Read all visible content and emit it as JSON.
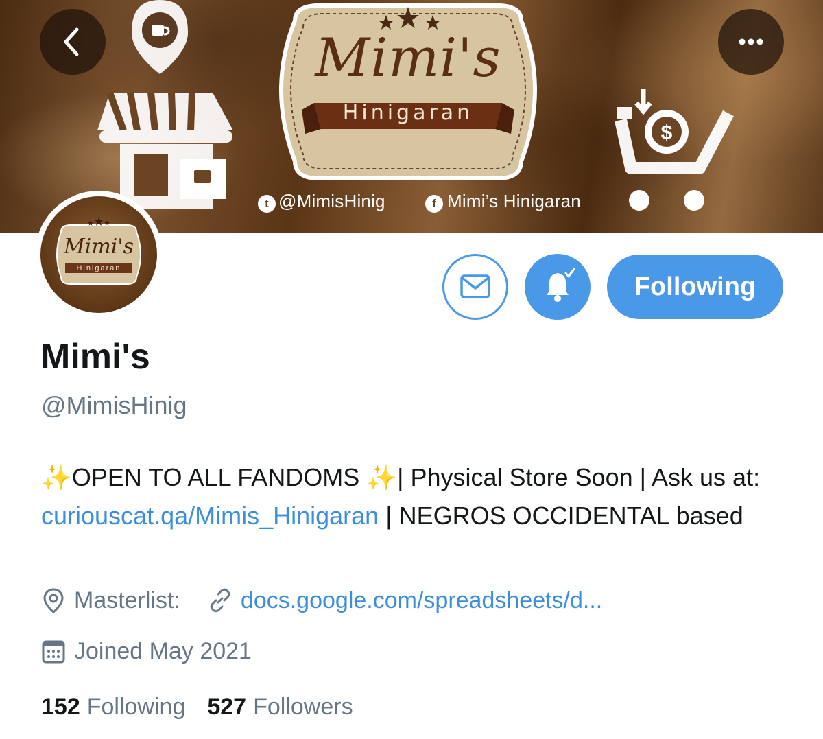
{
  "banner": {
    "logo_title": "Mimi's",
    "logo_subtitle": "Hinigaran",
    "twitter_text": "@MimisHinig",
    "facebook_text": "Mimi’s Hinigaran",
    "icons": [
      "location-pin-cup-icon",
      "storefront-icon",
      "shopping-cart-dollar-icon",
      "twitter-icon",
      "facebook-icon"
    ]
  },
  "nav": {
    "back_icon": "chevron-left-icon",
    "more_icon": "more-horizontal-icon"
  },
  "avatar": {
    "logo_title": "Mimi's",
    "logo_subtitle": "Hinigaran"
  },
  "actions": {
    "message_icon": "envelope-icon",
    "notify_icon": "bell-check-icon",
    "follow_label": "Following"
  },
  "profile": {
    "display_name": "Mimi's",
    "handle": "@MimisHinig",
    "bio": {
      "sparkle": "✨",
      "part1": "OPEN TO ALL FANDOMS ",
      "part2": "| Physical Store Soon | Ask us at: ",
      "link": "curiouscat.qa/Mimis_Hinigaran",
      "part3": " | NEGROS OCCIDENTAL based"
    },
    "location": "Masterlist:",
    "website": "docs.google.com/spreadsheets/d...",
    "joined": "Joined May 2021",
    "following_count": "152",
    "following_label": "Following",
    "followers_count": "527",
    "followers_label": "Followers"
  },
  "colors": {
    "accent": "#4a99e9",
    "link": "#3b8ede",
    "secondary_text": "#657786",
    "primary_text": "#14171a",
    "banner_brown": "#6b4423"
  }
}
